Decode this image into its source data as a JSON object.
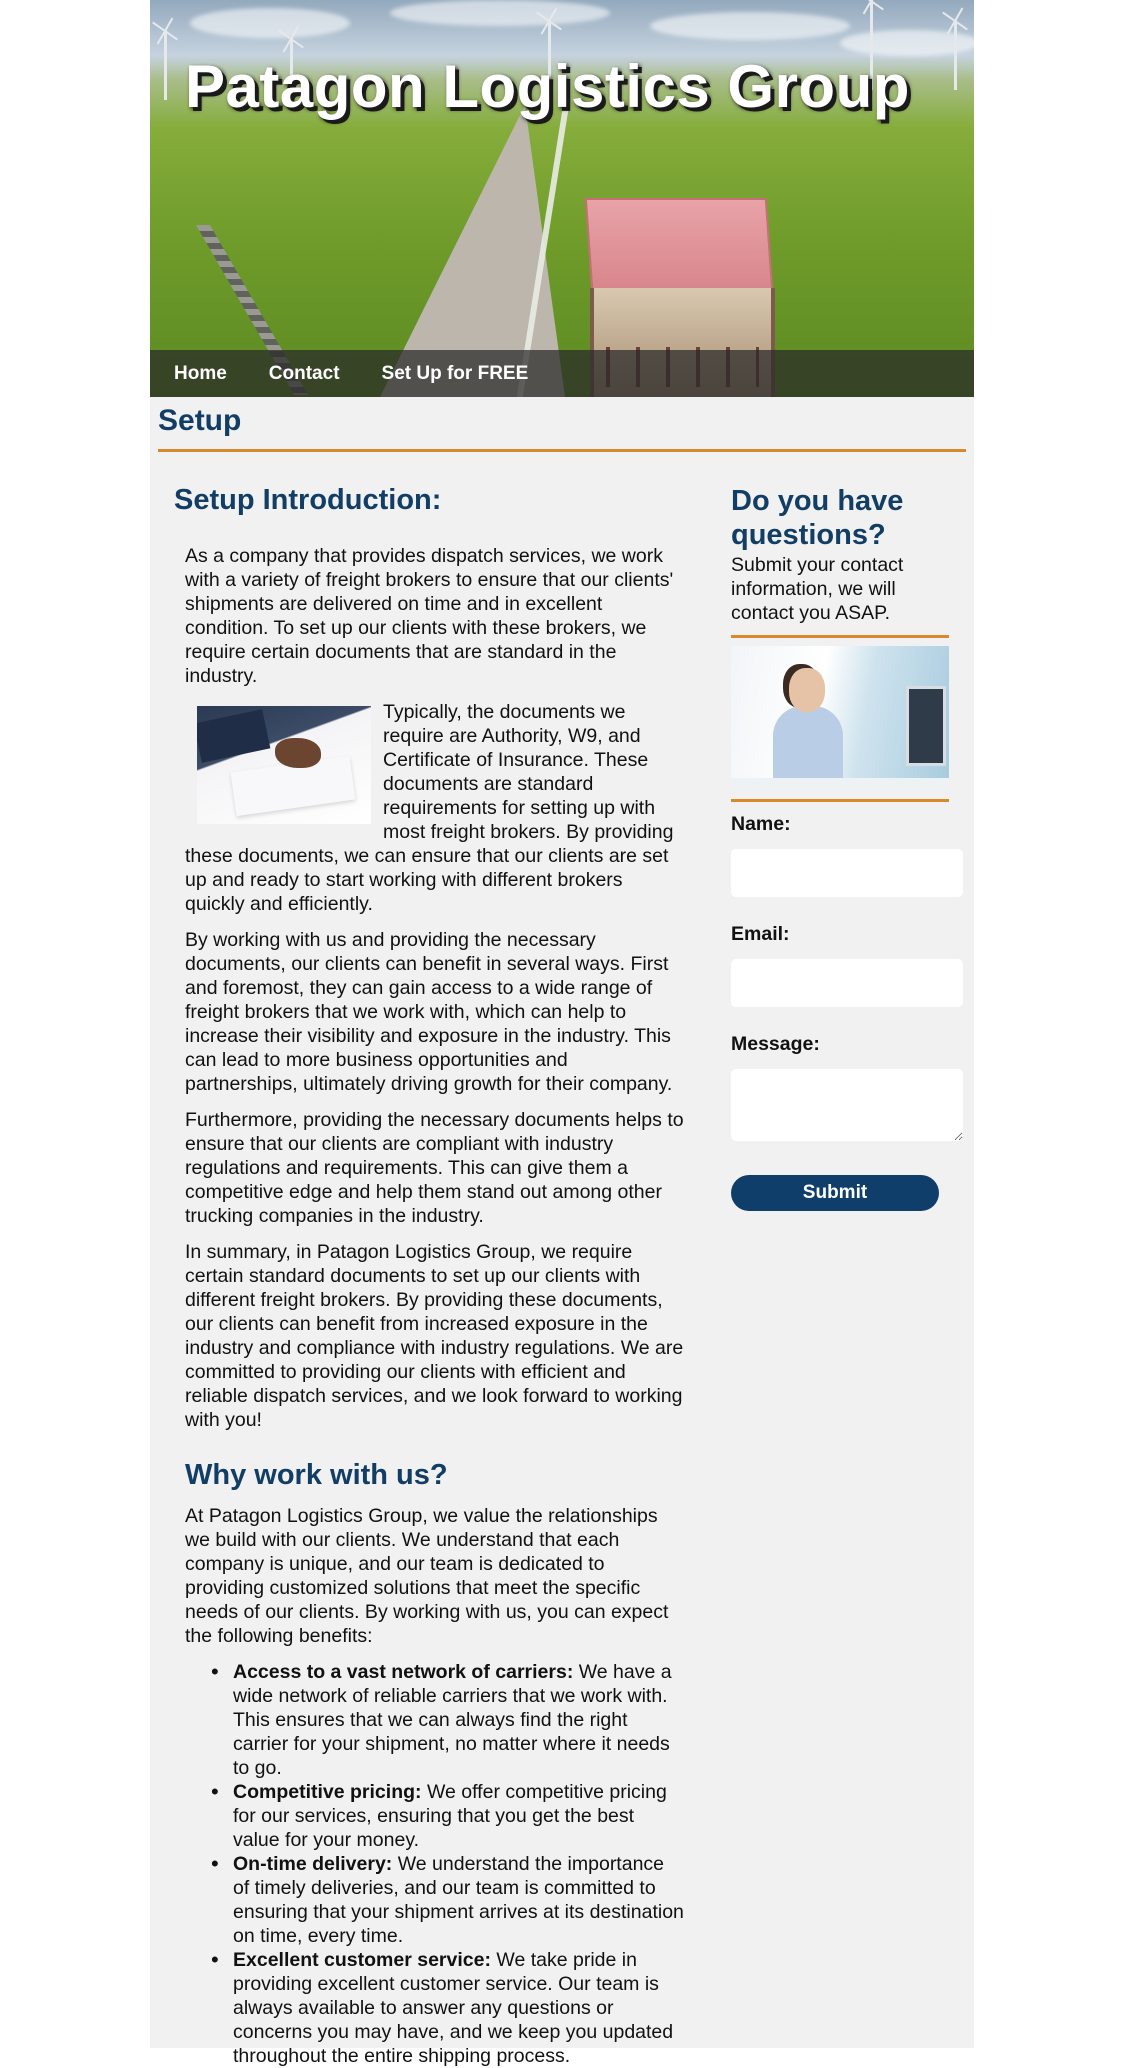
{
  "hero": {
    "title": "Patagon Logistics Group"
  },
  "nav": {
    "items": [
      "Home",
      "Contact",
      "Set Up for FREE"
    ]
  },
  "section": {
    "title": "Setup"
  },
  "main": {
    "intro_title": "Setup Introduction:",
    "p1": "As a company that provides dispatch services, we work with a variety of freight brokers to ensure that our clients' shipments are delivered on time and in excellent condition. To set up our clients with these brokers, we require certain documents that are standard in the industry.",
    "p2": "Typically, the documents we require are Authority, W9, and Certificate of Insurance. These documents are standard requirements for setting up with most freight brokers. By providing these documents, we can ensure that our clients are set up and ready to start working with different brokers quickly and efficiently.",
    "p3": "By working with us and providing the necessary documents, our clients can benefit in several ways. First and foremost, they can gain access to a wide range of freight brokers that we work with, which can help to increase their visibility and exposure in the industry. This can lead to more business opportunities and partnerships, ultimately driving growth for their company.",
    "p4": "Furthermore, providing the necessary documents helps to ensure that our clients are compliant with industry regulations and requirements. This can give them a competitive edge and help them stand out among other trucking companies in the industry.",
    "p5": "In summary, in Patagon Logistics Group, we require certain standard documents to set up our clients with different freight brokers. By providing these documents, our clients can benefit from increased exposure in the industry and compliance with industry regulations. We are committed to providing our clients with efficient and reliable dispatch services, and we look forward to working with you!",
    "why_title": "Why work with us?",
    "why_p": "At Patagon Logistics Group, we value the relationships we build with our clients. We understand that each company is unique, and our team is dedicated to providing customized solutions that meet the specific needs of our clients. By working with us, you can expect the following benefits:",
    "benefits": [
      {
        "title": "Access to a vast network of carriers:",
        "text": " We have a wide network of reliable carriers that we work with. This ensures that we can always find the right carrier for your shipment, no matter where it needs to go."
      },
      {
        "title": "Competitive pricing:",
        "text": " We offer competitive pricing for our services, ensuring that you get the best value for your money."
      },
      {
        "title": "On-time delivery:",
        "text": " We understand the importance of timely deliveries, and our team is committed to ensuring that your shipment arrives at its destination on time, every time."
      },
      {
        "title": "Excellent customer service:",
        "text": " We take pride in providing excellent customer service. Our team is always available to answer any questions or concerns you may have, and we keep you updated throughout the entire shipping process."
      }
    ]
  },
  "sidebar": {
    "title": "Do you have questions?",
    "intro": "Submit your contact information, we will contact you ASAP.",
    "form": {
      "name_label": "Name:",
      "email_label": "Email:",
      "message_label": "Message:",
      "submit_label": "Submit"
    }
  },
  "colors": {
    "heading": "#123e66",
    "accent": "#d68a2d",
    "button": "#103e6a",
    "page_bg": "#f1f1f1"
  },
  "icons": {
    "bullet": "disc-bullet"
  }
}
